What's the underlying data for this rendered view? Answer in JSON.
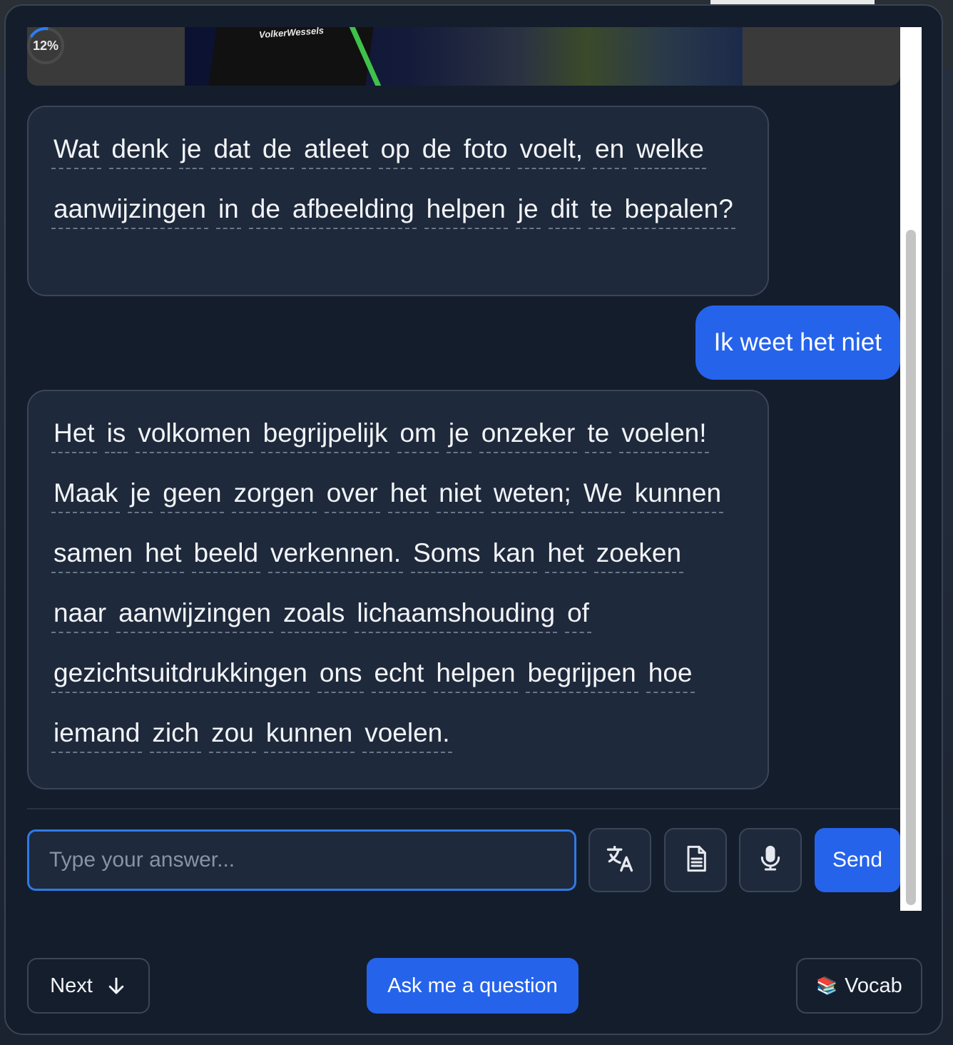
{
  "media": {
    "progress_label": "12%",
    "sponsor_text": "VolkerWessels",
    "close_icon": "close-icon"
  },
  "messages": [
    {
      "role": "assistant",
      "words": [
        "Wat",
        "denk",
        "je",
        "dat",
        "de",
        "atleet",
        "op",
        "de",
        "foto",
        "voelt,",
        "en",
        "welke",
        "aanwijzingen",
        "in",
        "de",
        "afbeelding",
        "helpen",
        "je",
        "dit",
        "te",
        "bepalen?"
      ]
    },
    {
      "role": "user",
      "text": "Ik weet het niet"
    },
    {
      "role": "assistant",
      "words": [
        "Het",
        "is",
        "volkomen",
        "begrijpelijk",
        "om",
        "je",
        "onzeker",
        "te",
        "voelen!",
        "Maak",
        "je",
        "geen",
        "zorgen",
        "over",
        "het",
        "niet",
        "weten;",
        "We",
        "kunnen",
        "samen",
        "het",
        "beeld",
        "verkennen.",
        "Soms",
        "kan",
        "het",
        "zoeken",
        "naar",
        "aanwijzingen",
        "zoals",
        "lichaamshouding",
        "of",
        "gezichtsuitdrukkingen",
        "ons",
        "echt",
        "helpen",
        "begrijpen",
        "hoe",
        "iemand",
        "zich",
        "zou",
        "kunnen",
        "voelen."
      ]
    }
  ],
  "input": {
    "placeholder": "Type your answer...",
    "value": ""
  },
  "actions": {
    "translate_icon": "translate-icon",
    "document_icon": "document-icon",
    "microphone_icon": "microphone-icon",
    "send_label": "Send"
  },
  "footer": {
    "next_label": "Next",
    "ask_label": "Ask me a question",
    "vocab_label": "Vocab",
    "vocab_icon": "📚"
  },
  "colors": {
    "accent": "#2563eb",
    "bubble_ai": "#1e293b",
    "modal_bg": "#141d2c"
  }
}
